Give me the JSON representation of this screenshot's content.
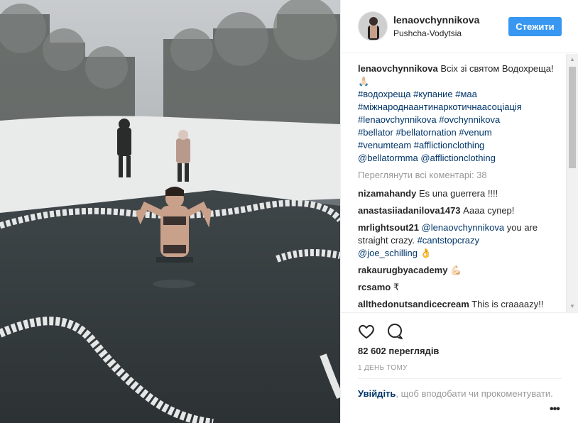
{
  "header": {
    "username": "lenaovchynnikova",
    "location": "Pushcha-Vodytsia",
    "follow_label": "Стежити"
  },
  "caption": {
    "username": "lenaovchynnikova",
    "text": "Всіх зі святом Водохреща! 🙏🏻",
    "hashtags": [
      "#водохреща",
      "#купание",
      "#маа",
      "#міжнароднаантинаркотичнаасоціація",
      "#lenaovchynnikova",
      "#ovchynnikova",
      "#bellator",
      "#bellatornation",
      "#venum",
      "#venumteam",
      "#afflictionclothing",
      "@bellatormma",
      "@afflictionclothing"
    ]
  },
  "view_all_comments": "Переглянути всі коментарі: 38",
  "comments": [
    {
      "user": "nizamahandy",
      "text": "Es una guerrera !!!!"
    },
    {
      "user": "anastasiiadanilova1473",
      "text": "Аааа супер!"
    },
    {
      "user": "mrlightsout21",
      "mention": "@lenaovchynnikova",
      "text": "you are straight crazy.",
      "hashtag": "#cantstopcrazy",
      "mention2": "@joe_schilling",
      "emoji": "👌"
    },
    {
      "user": "rakaurugbyacademy",
      "text": "💪🏻"
    },
    {
      "user": "rcsamo",
      "text": "₹"
    },
    {
      "user": "allthedonutsandicecream",
      "text": "This is craaaazy!!"
    }
  ],
  "actions": {
    "like_icon": "heart-icon",
    "comment_icon": "speech-bubble-icon",
    "views": "82 602 переглядів",
    "time": "1 день тому"
  },
  "login": {
    "link": "Увійдіть",
    "text": ", щоб вподобати чи прокоментувати."
  },
  "more_label": "•••",
  "colors": {
    "accent": "#3897f0",
    "link": "#003569",
    "muted": "#999999"
  }
}
